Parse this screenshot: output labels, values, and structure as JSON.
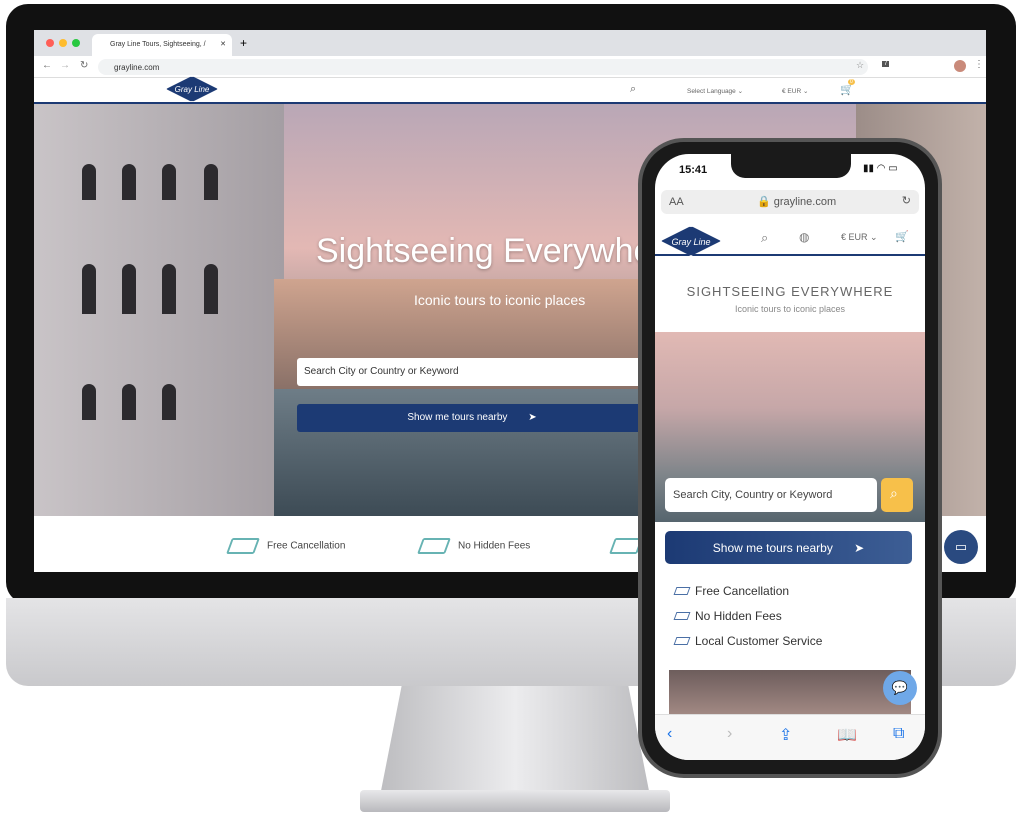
{
  "browser": {
    "tab_title": "Gray Line Tours, Sightseeing, /",
    "url": "grayline.com",
    "extension_badge": "7"
  },
  "site": {
    "logo": "Gray Line",
    "select_language": "Select Language",
    "currency": "€ EUR",
    "cart_count": "0"
  },
  "hero": {
    "title": "Sightseeing Everywhere",
    "subtitle": "Iconic tours to iconic places",
    "search_placeholder": "Search City or Country or Keyword",
    "nearby_button": "Show me tours nearby"
  },
  "features": [
    "Free Cancellation",
    "No Hidden Fees",
    "Local Customer Service"
  ],
  "phone": {
    "time": "15:41",
    "text_size": "AA",
    "url": "grayline.com",
    "currency": "€ EUR",
    "hero_title": "SIGHTSEEING EVERYWHERE",
    "hero_subtitle": "Iconic tours to iconic places",
    "search_placeholder": "Search City, Country or Keyword",
    "nearby_button": "Show me tours nearby"
  },
  "colors": {
    "brand": "#1c3a74",
    "accent": "#f7c04a",
    "check": "#67b3b3"
  }
}
